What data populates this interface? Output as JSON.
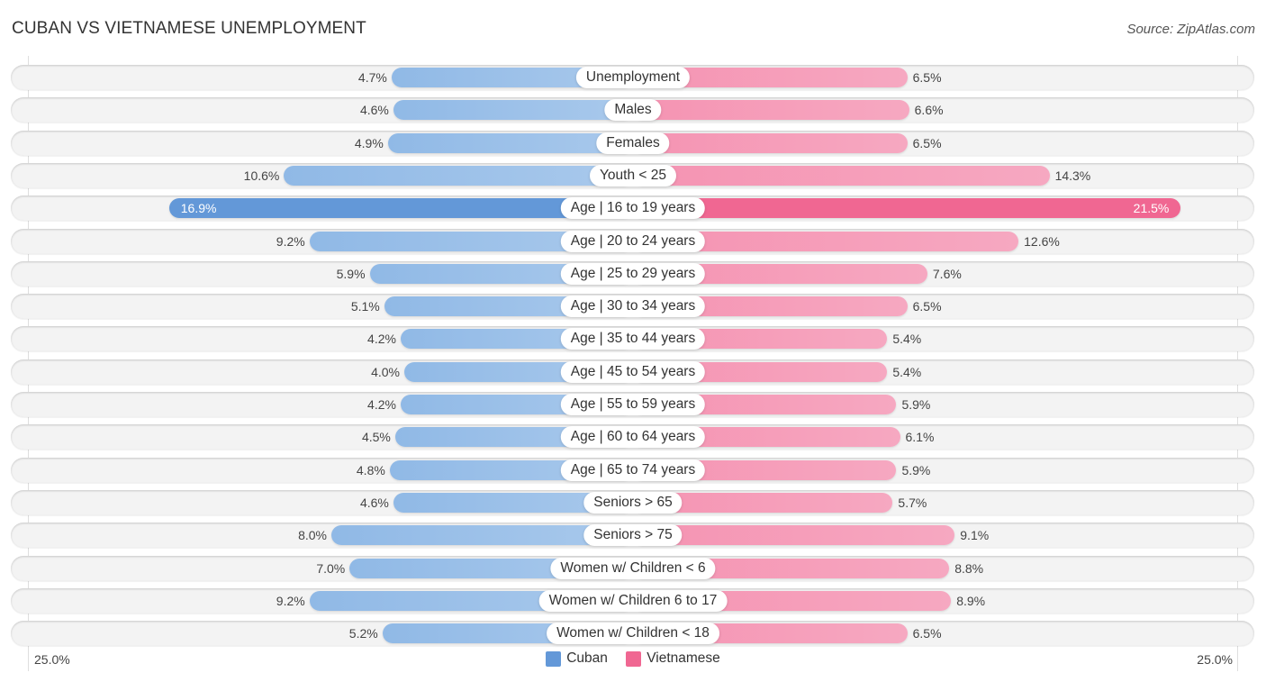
{
  "chart_data": {
    "type": "bar",
    "orientation": "horizontal-diverging",
    "title": "CUBAN VS VIETNAMESE UNEMPLOYMENT",
    "source": "Source: ZipAtlas.com",
    "categories": [
      "Unemployment",
      "Males",
      "Females",
      "Youth < 25",
      "Age | 16 to 19 years",
      "Age | 20 to 24 years",
      "Age | 25 to 29 years",
      "Age | 30 to 34 years",
      "Age | 35 to 44 years",
      "Age | 45 to 54 years",
      "Age | 55 to 59 years",
      "Age | 60 to 64 years",
      "Age | 65 to 74 years",
      "Seniors > 65",
      "Seniors > 75",
      "Women w/ Children < 6",
      "Women w/ Children 6 to 17",
      "Women w/ Children < 18"
    ],
    "series": [
      {
        "name": "Cuban",
        "color": "#6398d8",
        "side": "left",
        "values": [
          4.7,
          4.6,
          4.9,
          10.6,
          16.9,
          9.2,
          5.9,
          5.1,
          4.2,
          4.0,
          4.2,
          4.5,
          4.8,
          4.6,
          8.0,
          7.0,
          9.2,
          5.2
        ],
        "labels": [
          "4.7%",
          "4.6%",
          "4.9%",
          "10.6%",
          "16.9%",
          "9.2%",
          "5.9%",
          "5.1%",
          "4.2%",
          "4.0%",
          "4.2%",
          "4.5%",
          "4.8%",
          "4.6%",
          "8.0%",
          "7.0%",
          "9.2%",
          "5.2%"
        ]
      },
      {
        "name": "Vietnamese",
        "color": "#f06792",
        "side": "right",
        "values": [
          6.5,
          6.6,
          6.5,
          14.3,
          21.5,
          12.6,
          7.6,
          6.5,
          5.4,
          5.4,
          5.9,
          6.1,
          5.9,
          5.7,
          9.1,
          8.8,
          8.9,
          6.5
        ],
        "labels": [
          "6.5%",
          "6.6%",
          "6.5%",
          "14.3%",
          "21.5%",
          "12.6%",
          "7.6%",
          "6.5%",
          "5.4%",
          "5.4%",
          "5.9%",
          "6.1%",
          "5.9%",
          "5.7%",
          "9.1%",
          "8.8%",
          "8.9%",
          "6.5%"
        ]
      }
    ],
    "highlight_index": 4,
    "axis": {
      "left_label": "25.0%",
      "right_label": "25.0%",
      "max": 25.0
    },
    "legend": {
      "placement": "bottom-center",
      "items": [
        "Cuban",
        "Vietnamese"
      ]
    },
    "grid": false
  }
}
